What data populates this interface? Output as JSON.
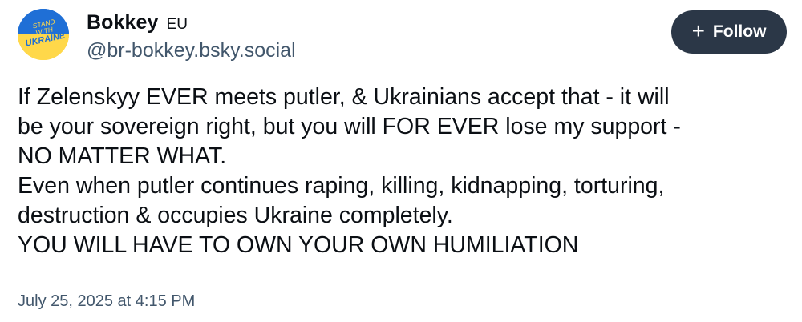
{
  "author": {
    "display_name": "Bokkey",
    "badge": "EU",
    "handle": "@br-bokkey.bsky.social",
    "avatar": {
      "icon": "ukraine-flag-avatar",
      "text_line1": "I STAND",
      "text_line2": "WITH",
      "text_line3": "UKRAINE",
      "top_color": "#1f6fd6",
      "bottom_color": "#ffd84a"
    }
  },
  "follow_button": {
    "icon": "plus-icon",
    "label": "Follow",
    "background": "#2b3747"
  },
  "post": {
    "lines": [
      "If Zelenskyy EVER meets putler, & Ukrainians accept that - it will",
      "be your sovereign right, but you will FOR EVER lose my support -",
      "NO MATTER WHAT.",
      "Even when putler continues raping, killing, kidnapping, torturing,",
      "destruction & occupies Ukraine completely.",
      "YOU WILL HAVE TO OWN YOUR OWN HUMILIATION"
    ],
    "timestamp": "July 25, 2025 at 4:15 PM"
  }
}
